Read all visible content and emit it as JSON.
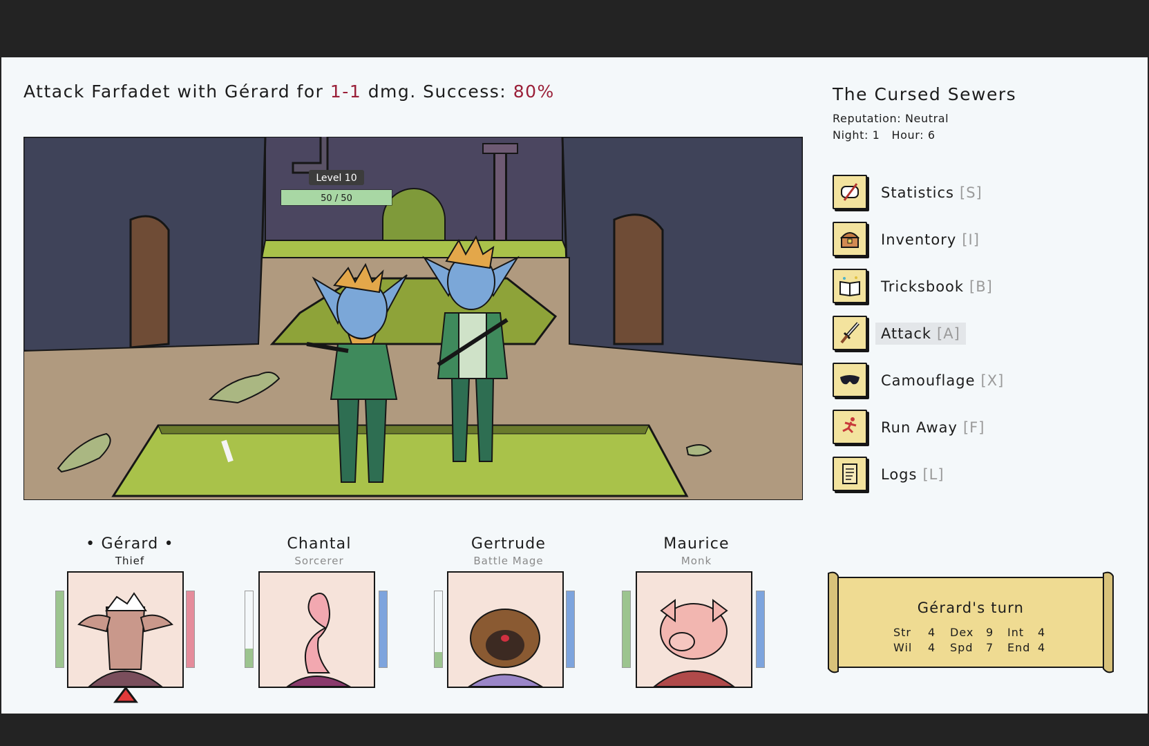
{
  "action": {
    "prefix": "Attack Farfadet with Gérard for",
    "damage": "1-1",
    "middle": "dmg. Success:",
    "success": "80%"
  },
  "enemy": {
    "level_label": "Level 10",
    "hp_text": "50 / 50",
    "hp_fraction": 1.0
  },
  "location": {
    "title": "The Cursed Sewers",
    "reputation": "Reputation: Neutral",
    "time": "Night: 1   Hour: 6"
  },
  "menu": [
    {
      "label": "Statistics",
      "key": "[S]",
      "icon": "scroll-quill-icon",
      "active": false
    },
    {
      "label": "Inventory",
      "key": "[I]",
      "icon": "treasure-chest-icon",
      "active": false
    },
    {
      "label": "Tricksbook",
      "key": "[B]",
      "icon": "spellbook-icon",
      "active": false
    },
    {
      "label": "Attack",
      "key": "[A]",
      "icon": "dagger-icon",
      "active": true
    },
    {
      "label": "Camouflage",
      "key": "[X]",
      "icon": "mask-icon",
      "active": false
    },
    {
      "label": "Run Away",
      "key": "[F]",
      "icon": "running-figure-icon",
      "active": false
    },
    {
      "label": "Logs",
      "key": "[L]",
      "icon": "parchment-icon",
      "active": false
    }
  ],
  "party": [
    {
      "name": "• Gérard •",
      "class": "Thief",
      "active": true,
      "portrait": "goat-portrait",
      "health": 1.0,
      "resource": 1.0,
      "resource_color": "#e58c9b"
    },
    {
      "name": "Chantal",
      "class": "Sorcerer",
      "active": false,
      "portrait": "worm-portrait",
      "health": 0.25,
      "resource": 1.0,
      "resource_color": "#7da4dd"
    },
    {
      "name": "Gertrude",
      "class": "Battle Mage",
      "active": false,
      "portrait": "pug-portrait",
      "health": 0.2,
      "resource": 1.0,
      "resource_color": "#7da4dd"
    },
    {
      "name": "Maurice",
      "class": "Monk",
      "active": false,
      "portrait": "pig-portrait",
      "health": 1.0,
      "resource": 1.0,
      "resource_color": "#7da4dd"
    }
  ],
  "turn_panel": {
    "title": "Gérard's turn",
    "stats": [
      {
        "label": "Str",
        "value": "4"
      },
      {
        "label": "Dex",
        "value": "9"
      },
      {
        "label": "Int",
        "value": "4"
      },
      {
        "label": "Wil",
        "value": "4"
      },
      {
        "label": "Spd",
        "value": "7"
      },
      {
        "label": "End",
        "value": "4"
      }
    ]
  },
  "colors": {
    "highlight": "#9a1f38",
    "health_bar": "#9cc48f",
    "parchment": "#efdb92"
  }
}
